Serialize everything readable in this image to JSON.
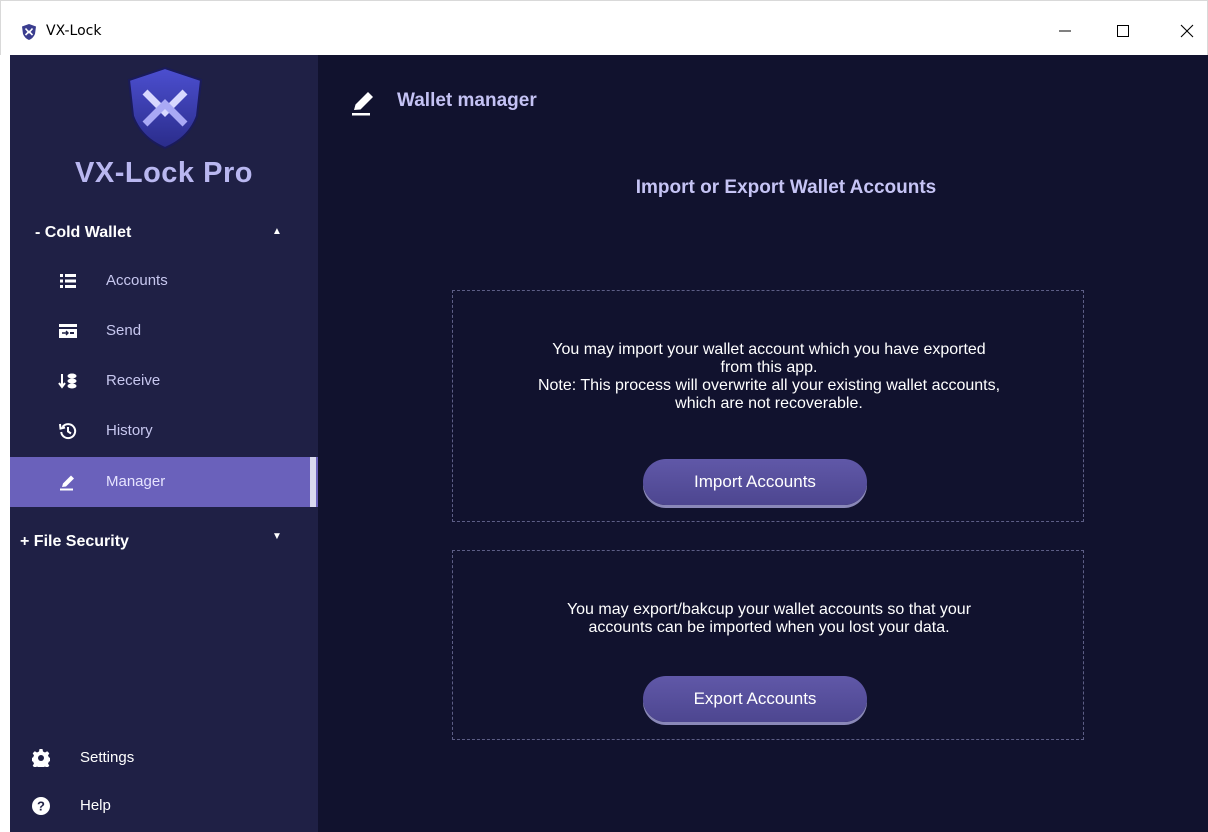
{
  "window": {
    "title": "VX-Lock",
    "minimize_glyph": "—",
    "maximize_glyph": "☐",
    "close_glyph": "✕"
  },
  "sidebar": {
    "brand": "VX-Lock Pro",
    "groups": [
      {
        "label": "-  Cold Wallet",
        "caret": "▲",
        "expanded": true,
        "items": [
          {
            "label": "Accounts",
            "icon": "list-icon"
          },
          {
            "label": "Send",
            "icon": "send-icon"
          },
          {
            "label": "Receive",
            "icon": "receive-icon"
          },
          {
            "label": "History",
            "icon": "history-icon"
          },
          {
            "label": "Manager",
            "icon": "pencil-icon",
            "active": true
          }
        ]
      },
      {
        "label": "+ File Security",
        "caret": "▼",
        "expanded": false
      }
    ],
    "bottom": [
      {
        "label": "Settings",
        "icon": "gear-icon"
      },
      {
        "label": "Help",
        "icon": "help-icon"
      }
    ]
  },
  "main": {
    "page_title": "Wallet manager",
    "subtitle": "Import or Export Wallet Accounts",
    "import_panel": {
      "lines": [
        "You may import your wallet account which you have exported",
        "from this app.",
        "Note: This process will overwrite all your existing wallet accounts,",
        "which are not recoverable."
      ],
      "button": "Import Accounts"
    },
    "export_panel": {
      "lines": [
        "You may export/bakcup your wallet accounts so that your",
        "accounts can be imported when you lost your data."
      ],
      "button": "Export Accounts"
    }
  },
  "colors": {
    "sidebar_bg": "#1f2045",
    "main_bg": "#11122e",
    "active_bg": "#6a61bb",
    "accent_text": "#c4c2f4",
    "button_bg": "#5850a0"
  }
}
